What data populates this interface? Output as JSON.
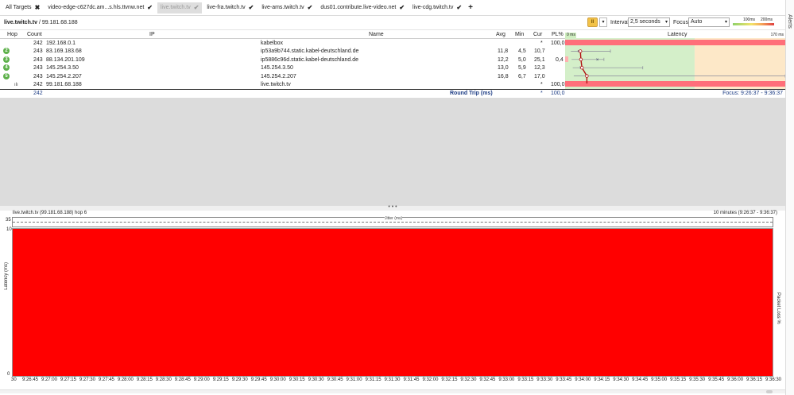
{
  "tabs": {
    "all_targets": "All Targets",
    "items": [
      {
        "label": "video-edge-c627dc.am...s.hls.ttvnw.net",
        "close": "✖",
        "active": false
      },
      {
        "label": "live.twitch.tv",
        "close": "✔",
        "active": true
      },
      {
        "label": "live-fra.twitch.tv",
        "close": "✔",
        "active": false
      },
      {
        "label": "live-ams.twitch.tv",
        "close": "✔",
        "active": false
      },
      {
        "label": "dus01.contribute.live-video.net",
        "close": "✔",
        "active": false
      },
      {
        "label": "live-cdg.twitch.tv",
        "close": "✔",
        "active": false
      }
    ],
    "add": "+"
  },
  "side": {
    "alerts": "Alerts"
  },
  "header": {
    "host": "live.twitch.tv",
    "ip_part": " / 99.181.68.188",
    "pause": "II",
    "options": "▾",
    "interval_label": "Interval",
    "interval_value": "2,5 seconds",
    "focus_label": "Focus",
    "focus_value": "Auto",
    "scale_100": "100ms",
    "scale_200": "200ms"
  },
  "table": {
    "headers": {
      "hop": "Hop",
      "count": "Count",
      "ip": "IP",
      "name": "Name",
      "avg": "Avg",
      "min": "Min",
      "cur": "Cur",
      "pl": "PL%",
      "latency": "Latency",
      "lat_min": "0 ms",
      "lat_max": "170 ms"
    },
    "rows": [
      {
        "hop": "",
        "count": "242",
        "ip": "192.168.0.1",
        "name": "kabelbox",
        "avg": "",
        "min": "",
        "cur": "*",
        "pl": "100,0"
      },
      {
        "hop": "2",
        "count": "243",
        "ip": "83.169.183.68",
        "name": "ip53a9b744.static.kabel-deutschland.de",
        "avg": "11,8",
        "min": "4,5",
        "cur": "10,7",
        "pl": ""
      },
      {
        "hop": "3",
        "count": "243",
        "ip": "88.134.201.109",
        "name": "ip5886c96d.static.kabel-deutschland.de",
        "avg": "12,2",
        "min": "5,0",
        "cur": "25,1",
        "pl": "0,4"
      },
      {
        "hop": "4",
        "count": "243",
        "ip": "145.254.3.50",
        "name": "145.254.3.50",
        "avg": "13,0",
        "min": "5,9",
        "cur": "12,3",
        "pl": ""
      },
      {
        "hop": "5",
        "count": "243",
        "ip": "145.254.2.207",
        "name": "145.254.2.207",
        "avg": "16,8",
        "min": "6,7",
        "cur": "17,0",
        "pl": ""
      },
      {
        "hop": "",
        "count": "242",
        "ip": "99.181.68.188",
        "name": "live.twitch.tv",
        "avg": "",
        "min": "",
        "cur": "*",
        "pl": "100,0"
      }
    ],
    "round_trip": {
      "count": "242",
      "label": "Round Trip (ms)",
      "cur": "*",
      "pl": "100,0",
      "focus": "Focus: 9:26:37 - 9:36:37"
    }
  },
  "divider": "• • •",
  "bottom": {
    "title": "live.twitch.tv (99.181.68.188) hop 6",
    "range": "10 minutes (9:26:37 - 9:36:37)",
    "jitter": "Jitter (ms)",
    "y_top": "35",
    "y_10": "10",
    "y_0": "0",
    "ylabel_left": "Latency (ms)",
    "ylabel_right": "Packet Loss %",
    "x_ticks": [
      "30",
      "9:26:45",
      "9:27:00",
      "9:27:15",
      "9:27:30",
      "9:27:45",
      "9:28:00",
      "9:28:15",
      "9:28:30",
      "9:28:45",
      "9:29:00",
      "9:29:15",
      "9:29:30",
      "9:29:45",
      "9:30:00",
      "9:30:15",
      "9:30:30",
      "9:30:45",
      "9:31:00",
      "9:31:15",
      "9:31:30",
      "9:31:45",
      "9:32:00",
      "9:32:15",
      "9:32:30",
      "9:32:45",
      "9:33:00",
      "9:33:15",
      "9:33:30",
      "9:33:45",
      "9:34:00",
      "9:34:15",
      "9:34:30",
      "9:34:45",
      "9:35:00",
      "9:35:15",
      "9:35:30",
      "9:35:45",
      "9:36:00",
      "9:36:15",
      "9:36:30"
    ]
  },
  "latency_graph": {
    "hops": [
      {
        "avg": 11.8,
        "min": 4.5,
        "cur": 10.7,
        "max": 35
      },
      {
        "avg": 12.2,
        "min": 5.0,
        "cur": 25.1,
        "max": 30
      },
      {
        "avg": 13.0,
        "min": 5.9,
        "cur": 12.3,
        "max": 60
      },
      {
        "avg": 16.8,
        "min": 6.7,
        "cur": 17.0,
        "max": 170
      }
    ],
    "scale_max_ms": 170,
    "colors": {
      "loss": "#ff6f7a",
      "green": "#d4efc9",
      "orange": "#fde8c8",
      "line": "#b01010",
      "marker": "#333366"
    }
  },
  "colors": {
    "red": "#ff0000",
    "hop_badge": "#5db04a",
    "round_trip": "#1d3d85"
  }
}
